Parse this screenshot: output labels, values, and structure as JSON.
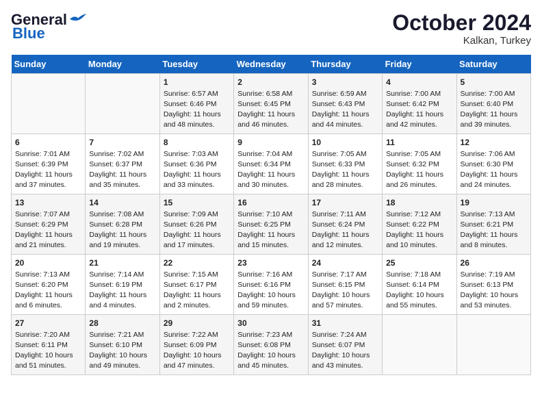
{
  "logo": {
    "line1": "General",
    "line2": "Blue"
  },
  "title": "October 2024",
  "location": "Kalkan, Turkey",
  "days_header": [
    "Sunday",
    "Monday",
    "Tuesday",
    "Wednesday",
    "Thursday",
    "Friday",
    "Saturday"
  ],
  "weeks": [
    [
      {
        "day": "",
        "info": ""
      },
      {
        "day": "",
        "info": ""
      },
      {
        "day": "1",
        "info": "Sunrise: 6:57 AM\nSunset: 6:46 PM\nDaylight: 11 hours and 48 minutes."
      },
      {
        "day": "2",
        "info": "Sunrise: 6:58 AM\nSunset: 6:45 PM\nDaylight: 11 hours and 46 minutes."
      },
      {
        "day": "3",
        "info": "Sunrise: 6:59 AM\nSunset: 6:43 PM\nDaylight: 11 hours and 44 minutes."
      },
      {
        "day": "4",
        "info": "Sunrise: 7:00 AM\nSunset: 6:42 PM\nDaylight: 11 hours and 42 minutes."
      },
      {
        "day": "5",
        "info": "Sunrise: 7:00 AM\nSunset: 6:40 PM\nDaylight: 11 hours and 39 minutes."
      }
    ],
    [
      {
        "day": "6",
        "info": "Sunrise: 7:01 AM\nSunset: 6:39 PM\nDaylight: 11 hours and 37 minutes."
      },
      {
        "day": "7",
        "info": "Sunrise: 7:02 AM\nSunset: 6:37 PM\nDaylight: 11 hours and 35 minutes."
      },
      {
        "day": "8",
        "info": "Sunrise: 7:03 AM\nSunset: 6:36 PM\nDaylight: 11 hours and 33 minutes."
      },
      {
        "day": "9",
        "info": "Sunrise: 7:04 AM\nSunset: 6:34 PM\nDaylight: 11 hours and 30 minutes."
      },
      {
        "day": "10",
        "info": "Sunrise: 7:05 AM\nSunset: 6:33 PM\nDaylight: 11 hours and 28 minutes."
      },
      {
        "day": "11",
        "info": "Sunrise: 7:05 AM\nSunset: 6:32 PM\nDaylight: 11 hours and 26 minutes."
      },
      {
        "day": "12",
        "info": "Sunrise: 7:06 AM\nSunset: 6:30 PM\nDaylight: 11 hours and 24 minutes."
      }
    ],
    [
      {
        "day": "13",
        "info": "Sunrise: 7:07 AM\nSunset: 6:29 PM\nDaylight: 11 hours and 21 minutes."
      },
      {
        "day": "14",
        "info": "Sunrise: 7:08 AM\nSunset: 6:28 PM\nDaylight: 11 hours and 19 minutes."
      },
      {
        "day": "15",
        "info": "Sunrise: 7:09 AM\nSunset: 6:26 PM\nDaylight: 11 hours and 17 minutes."
      },
      {
        "day": "16",
        "info": "Sunrise: 7:10 AM\nSunset: 6:25 PM\nDaylight: 11 hours and 15 minutes."
      },
      {
        "day": "17",
        "info": "Sunrise: 7:11 AM\nSunset: 6:24 PM\nDaylight: 11 hours and 12 minutes."
      },
      {
        "day": "18",
        "info": "Sunrise: 7:12 AM\nSunset: 6:22 PM\nDaylight: 11 hours and 10 minutes."
      },
      {
        "day": "19",
        "info": "Sunrise: 7:13 AM\nSunset: 6:21 PM\nDaylight: 11 hours and 8 minutes."
      }
    ],
    [
      {
        "day": "20",
        "info": "Sunrise: 7:13 AM\nSunset: 6:20 PM\nDaylight: 11 hours and 6 minutes."
      },
      {
        "day": "21",
        "info": "Sunrise: 7:14 AM\nSunset: 6:19 PM\nDaylight: 11 hours and 4 minutes."
      },
      {
        "day": "22",
        "info": "Sunrise: 7:15 AM\nSunset: 6:17 PM\nDaylight: 11 hours and 2 minutes."
      },
      {
        "day": "23",
        "info": "Sunrise: 7:16 AM\nSunset: 6:16 PM\nDaylight: 10 hours and 59 minutes."
      },
      {
        "day": "24",
        "info": "Sunrise: 7:17 AM\nSunset: 6:15 PM\nDaylight: 10 hours and 57 minutes."
      },
      {
        "day": "25",
        "info": "Sunrise: 7:18 AM\nSunset: 6:14 PM\nDaylight: 10 hours and 55 minutes."
      },
      {
        "day": "26",
        "info": "Sunrise: 7:19 AM\nSunset: 6:13 PM\nDaylight: 10 hours and 53 minutes."
      }
    ],
    [
      {
        "day": "27",
        "info": "Sunrise: 7:20 AM\nSunset: 6:11 PM\nDaylight: 10 hours and 51 minutes."
      },
      {
        "day": "28",
        "info": "Sunrise: 7:21 AM\nSunset: 6:10 PM\nDaylight: 10 hours and 49 minutes."
      },
      {
        "day": "29",
        "info": "Sunrise: 7:22 AM\nSunset: 6:09 PM\nDaylight: 10 hours and 47 minutes."
      },
      {
        "day": "30",
        "info": "Sunrise: 7:23 AM\nSunset: 6:08 PM\nDaylight: 10 hours and 45 minutes."
      },
      {
        "day": "31",
        "info": "Sunrise: 7:24 AM\nSunset: 6:07 PM\nDaylight: 10 hours and 43 minutes."
      },
      {
        "day": "",
        "info": ""
      },
      {
        "day": "",
        "info": ""
      }
    ]
  ]
}
